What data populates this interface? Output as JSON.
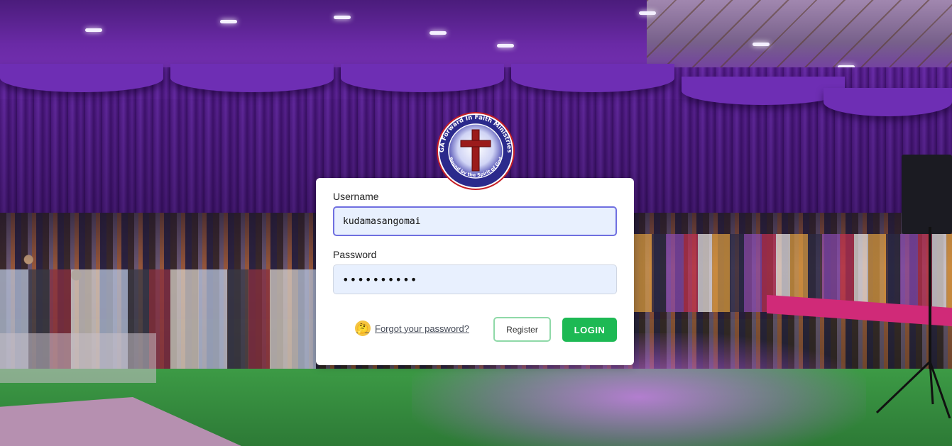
{
  "logo": {
    "ring_text": "ZAOGA Forward In Faith Ministries Int.",
    "motto": "Bound by the Spirit of God",
    "colors": {
      "ring": "#2b2a8c",
      "cross": "#9b1b1b"
    }
  },
  "login": {
    "username_label": "Username",
    "username_value": "kudamasangomai",
    "password_label": "Password",
    "password_value": "••••••••••",
    "forgot_emoji": "🤔",
    "forgot_label": "Forgot your password?",
    "register_label": "Register",
    "login_label": "LOGIN"
  },
  "colors": {
    "login_button": "#1db954",
    "register_border": "#8fd9a8",
    "input_fill": "#e8f0fe",
    "focus_border": "#6f6fe0"
  }
}
